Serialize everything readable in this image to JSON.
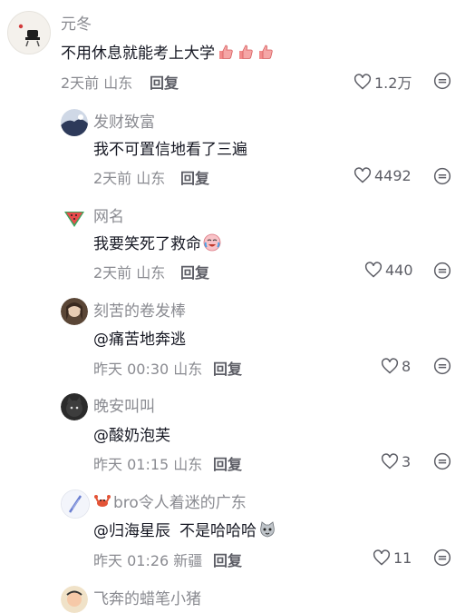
{
  "colors": {
    "meta": "#8a8b91",
    "text": "#161823",
    "reply": "#5d5e66"
  },
  "comments": [
    {
      "username": "元冬",
      "text": "不用休息就能考上大学",
      "emoji": "thumbs-up-emoji x3",
      "time": "2天前",
      "location": "山东",
      "reply": "回复",
      "likes": "1.2万"
    },
    {
      "username": "发财致富",
      "text": "我不可置信地看了三遍",
      "time": "2天前",
      "location": "山东",
      "reply": "回复",
      "likes": "4492"
    },
    {
      "username": "网名",
      "text": "我要笑死了救命",
      "emoji": "crying-laughing-emoji",
      "time": "2天前",
      "location": "山东",
      "reply": "回复",
      "likes": "440"
    },
    {
      "username": "刻苦的卷发棒",
      "text": "@痛苦地奔逃",
      "time": "昨天 00:30",
      "location": "山东",
      "reply": "回复",
      "likes": "8"
    },
    {
      "username": "晚安叫叫",
      "text": "@酸奶泡芙",
      "time": "昨天 01:15",
      "location": "山东",
      "reply": "回复",
      "likes": "3"
    },
    {
      "username": "bro令人着迷的广东",
      "username_emoji": "crab-emoji",
      "text_mention": "@归海星辰",
      "text": "不是哈哈哈",
      "emoji": "cat-emoji",
      "time": "昨天 01:26",
      "location": "新疆",
      "reply": "回复",
      "likes": "11"
    },
    {
      "username": "飞奔的蜡笔小猪"
    }
  ]
}
